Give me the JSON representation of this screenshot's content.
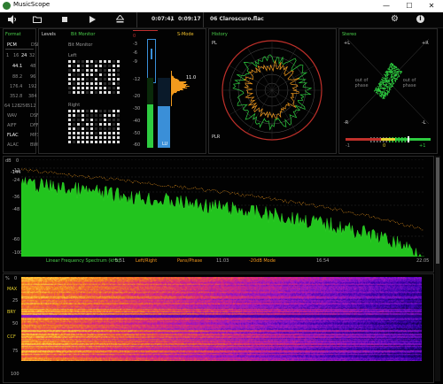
{
  "window": {
    "title": "MusicScope",
    "minimize": "—",
    "maximize": "☐",
    "close": "✕"
  },
  "toolbar": {
    "volume_icon": "volume-icon",
    "folder_icon": "folder-icon",
    "stop_icon": "stop-icon",
    "play_icon": "play-icon",
    "eject_icon": "eject-icon",
    "position": "0:07:41",
    "separator": "/",
    "elapsed": "0:09:17",
    "track": "06 Claroscuro.flac",
    "settings_icon": "gear-icon",
    "info_icon": "info-icon"
  },
  "format": {
    "title": "Format",
    "pcm": "PCM",
    "dsd": "DSD",
    "bits": [
      "1",
      "16",
      "24",
      "32"
    ],
    "rates_left": [
      "44.1",
      "88.2",
      "176.4",
      "352.8"
    ],
    "rates_right": [
      "48",
      "96",
      "192",
      "384"
    ],
    "dsd_rates": [
      "64",
      "128",
      "256",
      "512"
    ],
    "codecs_left": [
      "WAV",
      "AIFF",
      "FLAC",
      "ALAC"
    ],
    "codecs_right": [
      "DSF",
      "DFF",
      "MP3",
      "BWF"
    ]
  },
  "levels": {
    "title": "Levels",
    "bit_monitor_tab": "Bit Monitor",
    "bit_monitor_label": "Bit Monitor",
    "left": "Left",
    "right": "Right",
    "scale": [
      "0",
      "-3",
      "-6",
      "-9",
      "-12",
      "-20",
      "-30",
      "-40",
      "-50",
      "-60"
    ],
    "mode": "S-Mode",
    "peak_value": "11.0",
    "lu": "LU",
    "left_level": 0.62,
    "right_level": 0.6
  },
  "history": {
    "title": "History",
    "pl": "PL",
    "plr": "PLR"
  },
  "stereo": {
    "title": "Stereo",
    "plus_l": "+L",
    "plus_r": "+R",
    "minus_l": "-L",
    "minus_r": "-R",
    "out_of_phase_left": "out of phase",
    "out_of_phase_right": "out of phase",
    "corr_min": "-1",
    "corr_mid": "0",
    "corr_max": "+1"
  },
  "spectrum": {
    "ylabels": [
      "dB",
      "0",
      "-12",
      "-24",
      "-36",
      "-48",
      "-60",
      "-100",
      "-144"
    ],
    "xlabels": [
      "5.51",
      "11.03",
      "16.54",
      "22.05"
    ],
    "caption": "Linear Frequency Spectrum (kHz)",
    "mode1": "Left/Right",
    "mode2": "Pans/Phase",
    "mode3": "-20dB Mode"
  },
  "spectrogram": {
    "ylabels": [
      "%",
      "0",
      "25",
      "50",
      "75",
      "100"
    ],
    "markers": [
      "MAX",
      "BRY",
      "CCF"
    ]
  }
}
